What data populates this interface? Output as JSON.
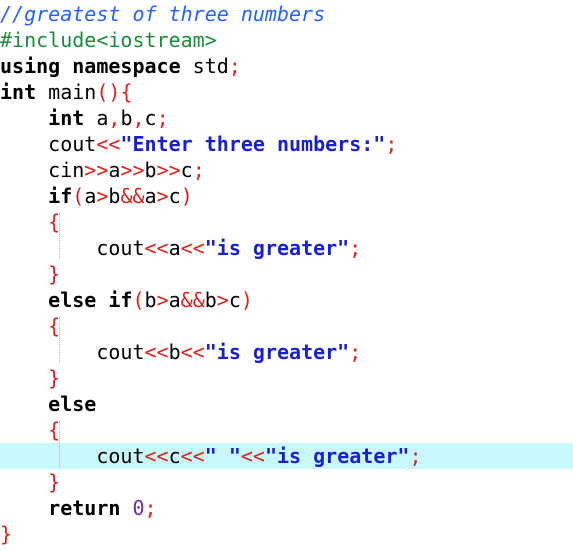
{
  "editor": {
    "lines": [
      {
        "highlight": false,
        "tokens": [
          {
            "t": "//greatest of three numbers",
            "c": "comment"
          }
        ]
      },
      {
        "highlight": false,
        "tokens": [
          {
            "t": "#include<iostream>",
            "c": "preproc"
          }
        ]
      },
      {
        "highlight": false,
        "tokens": [
          {
            "t": "using namespace",
            "c": "kw"
          },
          {
            "t": " std",
            "c": "plain"
          },
          {
            "t": ";",
            "c": "op"
          }
        ]
      },
      {
        "highlight": false,
        "tokens": [
          {
            "t": "int",
            "c": "kw"
          },
          {
            "t": " main",
            "c": "plain"
          },
          {
            "t": "()",
            "c": "paren"
          },
          {
            "t": "{",
            "c": "brace"
          }
        ]
      },
      {
        "highlight": false,
        "tokens": [
          {
            "t": "    ",
            "c": "plain"
          },
          {
            "t": "int",
            "c": "kw"
          },
          {
            "t": " a",
            "c": "plain"
          },
          {
            "t": ",",
            "c": "op"
          },
          {
            "t": "b",
            "c": "plain"
          },
          {
            "t": ",",
            "c": "op"
          },
          {
            "t": "c",
            "c": "plain"
          },
          {
            "t": ";",
            "c": "op"
          }
        ]
      },
      {
        "highlight": false,
        "tokens": [
          {
            "t": "    cout",
            "c": "plain"
          },
          {
            "t": "<<",
            "c": "op"
          },
          {
            "t": "\"Enter three numbers:\"",
            "c": "str"
          },
          {
            "t": ";",
            "c": "op"
          }
        ]
      },
      {
        "highlight": false,
        "tokens": [
          {
            "t": "    cin",
            "c": "plain"
          },
          {
            "t": ">>",
            "c": "op"
          },
          {
            "t": "a",
            "c": "plain"
          },
          {
            "t": ">>",
            "c": "op"
          },
          {
            "t": "b",
            "c": "plain"
          },
          {
            "t": ">>",
            "c": "op"
          },
          {
            "t": "c",
            "c": "plain"
          },
          {
            "t": ";",
            "c": "op"
          }
        ]
      },
      {
        "highlight": false,
        "tokens": [
          {
            "t": "    ",
            "c": "plain"
          },
          {
            "t": "if",
            "c": "kw"
          },
          {
            "t": "(",
            "c": "paren"
          },
          {
            "t": "a",
            "c": "plain"
          },
          {
            "t": ">",
            "c": "op"
          },
          {
            "t": "b",
            "c": "plain"
          },
          {
            "t": "&&",
            "c": "op"
          },
          {
            "t": "a",
            "c": "plain"
          },
          {
            "t": ">",
            "c": "op"
          },
          {
            "t": "c",
            "c": "plain"
          },
          {
            "t": ")",
            "c": "paren"
          }
        ]
      },
      {
        "highlight": false,
        "tokens": [
          {
            "t": "    ",
            "c": "plain"
          },
          {
            "t": "{",
            "c": "brace"
          }
        ]
      },
      {
        "highlight": false,
        "tokens": [
          {
            "t": "        cout",
            "c": "plain"
          },
          {
            "t": "<<",
            "c": "op"
          },
          {
            "t": "a",
            "c": "plain"
          },
          {
            "t": "<<",
            "c": "op"
          },
          {
            "t": "\"is greater\"",
            "c": "str"
          },
          {
            "t": ";",
            "c": "op"
          }
        ]
      },
      {
        "highlight": false,
        "tokens": [
          {
            "t": "    ",
            "c": "plain"
          },
          {
            "t": "}",
            "c": "brace"
          }
        ]
      },
      {
        "highlight": false,
        "tokens": [
          {
            "t": "    ",
            "c": "plain"
          },
          {
            "t": "else if",
            "c": "kw"
          },
          {
            "t": "(",
            "c": "paren"
          },
          {
            "t": "b",
            "c": "plain"
          },
          {
            "t": ">",
            "c": "op"
          },
          {
            "t": "a",
            "c": "plain"
          },
          {
            "t": "&&",
            "c": "op"
          },
          {
            "t": "b",
            "c": "plain"
          },
          {
            "t": ">",
            "c": "op"
          },
          {
            "t": "c",
            "c": "plain"
          },
          {
            "t": ")",
            "c": "paren"
          }
        ]
      },
      {
        "highlight": false,
        "tokens": [
          {
            "t": "    ",
            "c": "plain"
          },
          {
            "t": "{",
            "c": "brace"
          }
        ]
      },
      {
        "highlight": false,
        "tokens": [
          {
            "t": "        cout",
            "c": "plain"
          },
          {
            "t": "<<",
            "c": "op"
          },
          {
            "t": "b",
            "c": "plain"
          },
          {
            "t": "<<",
            "c": "op"
          },
          {
            "t": "\"is greater\"",
            "c": "str"
          },
          {
            "t": ";",
            "c": "op"
          }
        ]
      },
      {
        "highlight": false,
        "tokens": [
          {
            "t": "    ",
            "c": "plain"
          },
          {
            "t": "}",
            "c": "brace"
          }
        ]
      },
      {
        "highlight": false,
        "tokens": [
          {
            "t": "    ",
            "c": "plain"
          },
          {
            "t": "else",
            "c": "kw"
          }
        ]
      },
      {
        "highlight": false,
        "tokens": [
          {
            "t": "    ",
            "c": "plain"
          },
          {
            "t": "{",
            "c": "brace"
          }
        ]
      },
      {
        "highlight": true,
        "tokens": [
          {
            "t": "        cout",
            "c": "plain"
          },
          {
            "t": "<<",
            "c": "op"
          },
          {
            "t": "c",
            "c": "plain"
          },
          {
            "t": "<<",
            "c": "op"
          },
          {
            "t": "\" \"",
            "c": "str"
          },
          {
            "t": "<<",
            "c": "op"
          },
          {
            "t": "\"is greater\"",
            "c": "str"
          },
          {
            "t": ";",
            "c": "op"
          }
        ]
      },
      {
        "highlight": false,
        "tokens": [
          {
            "t": "    ",
            "c": "plain"
          },
          {
            "t": "}",
            "c": "brace"
          }
        ]
      },
      {
        "highlight": false,
        "tokens": [
          {
            "t": "    ",
            "c": "plain"
          },
          {
            "t": "return",
            "c": "kw"
          },
          {
            "t": " ",
            "c": "plain"
          },
          {
            "t": "0",
            "c": "num"
          },
          {
            "t": ";",
            "c": "op"
          }
        ]
      },
      {
        "highlight": false,
        "tokens": [
          {
            "t": "}",
            "c": "brace"
          }
        ]
      }
    ]
  },
  "colors": {
    "keyword": "#000000",
    "operator": "#e0201c",
    "string": "#1a20cc",
    "comment": "#2563ff",
    "preprocessor": "#1f8a3c",
    "number": "#7a2aa8",
    "current_line": "#c8f8fb"
  }
}
